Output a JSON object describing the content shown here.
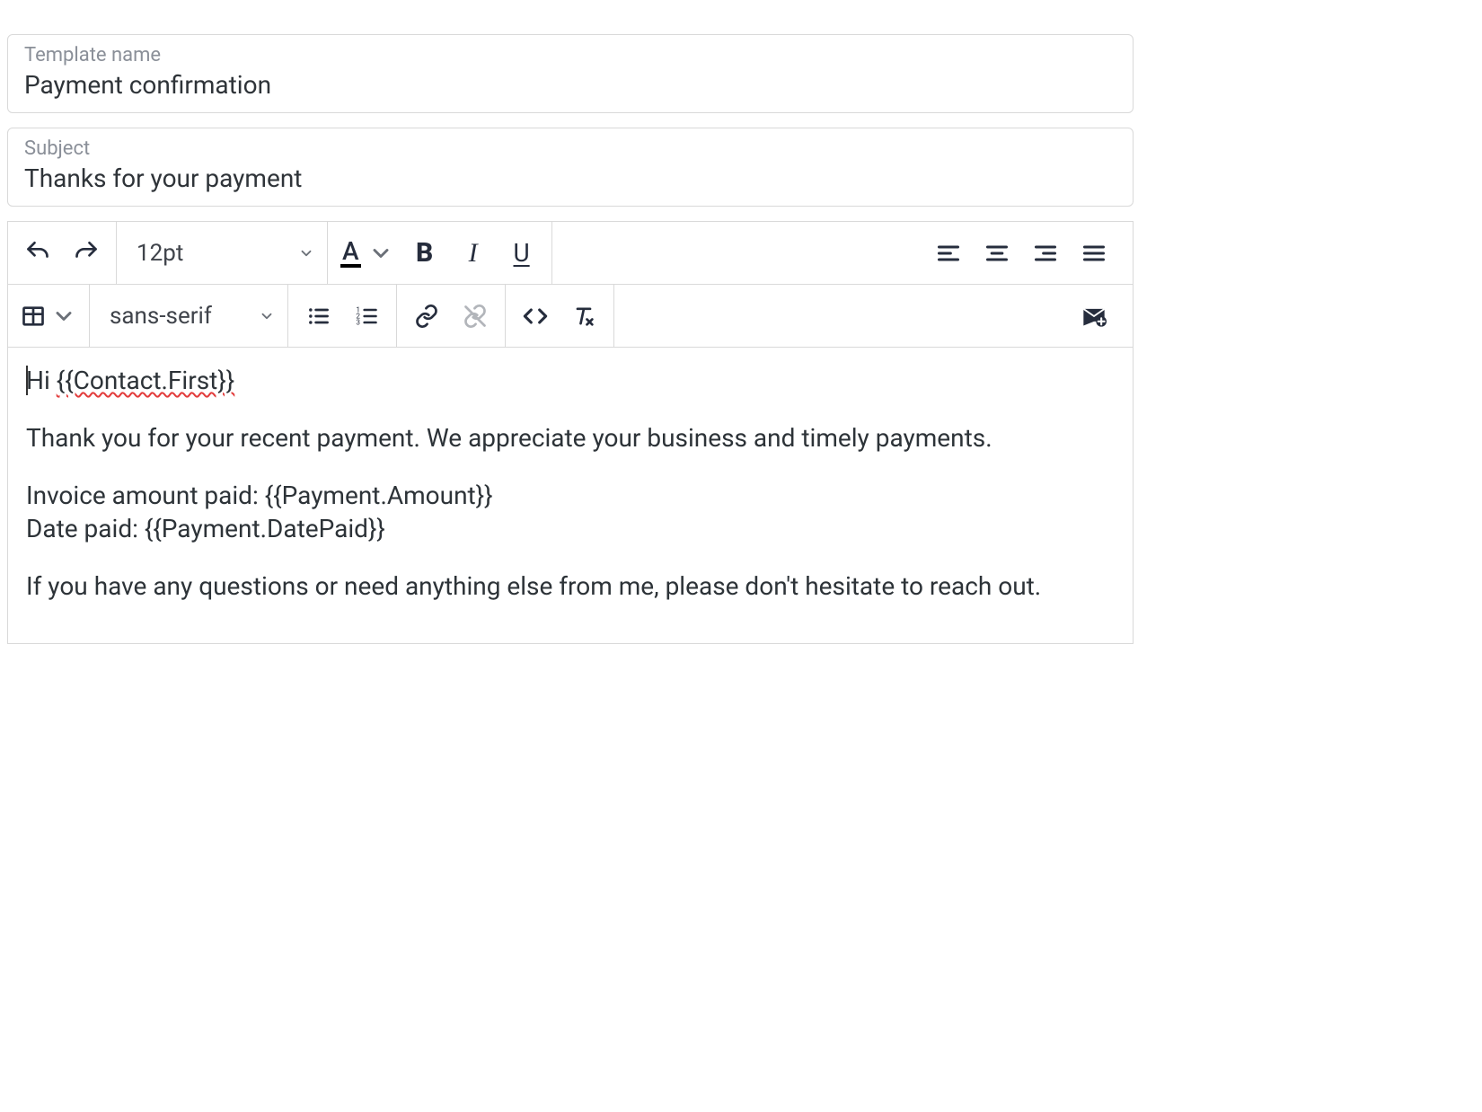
{
  "fields": {
    "template_name": {
      "label": "Template name",
      "value": "Payment confirmation"
    },
    "subject": {
      "label": "Subject",
      "value": "Thanks for your payment"
    }
  },
  "toolbar": {
    "font_size": "12pt",
    "font_family": "sans-serif"
  },
  "body": {
    "greeting_prefix": "Hi ",
    "greeting_token": "{{Contact.First}}",
    "p1": "Thank you for your recent payment. We appreciate your business and timely payments.",
    "line_invoice": "Invoice amount paid: {{Payment.Amount}}",
    "line_date": "Date paid: {{Payment.DatePaid}}",
    "p2": "If you have any questions or need anything else from me, please don't hesitate to reach out."
  }
}
